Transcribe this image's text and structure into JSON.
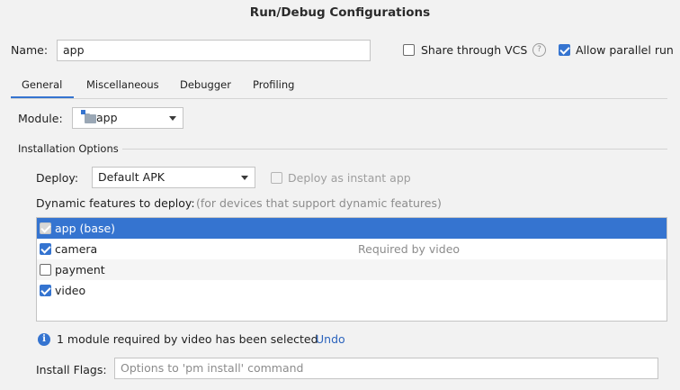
{
  "dialog": {
    "title": "Run/Debug Configurations"
  },
  "name_row": {
    "label": "Name:",
    "value": "app",
    "share_vcs_label": "Share through VCS",
    "share_vcs_checked": false,
    "help_glyph": "?",
    "allow_parallel_label": "Allow parallel run",
    "allow_parallel_checked": true
  },
  "tabs": [
    {
      "label": "General",
      "active": true
    },
    {
      "label": "Miscellaneous",
      "active": false
    },
    {
      "label": "Debugger",
      "active": false
    },
    {
      "label": "Profiling",
      "active": false
    }
  ],
  "module": {
    "label": "Module:",
    "value": "app",
    "icon": "module-folder-icon"
  },
  "installation": {
    "section_title": "Installation Options",
    "deploy_label": "Deploy:",
    "deploy_value": "Default APK",
    "instant_app_label": "Deploy as instant app",
    "instant_app_checked": false,
    "dynamic_label": "Dynamic features to deploy:",
    "dynamic_hint": "(for devices that support dynamic features)",
    "features": [
      {
        "name": "app (base)",
        "checked": true,
        "disabled": true,
        "selected": true,
        "note": ""
      },
      {
        "name": "camera",
        "checked": true,
        "disabled": false,
        "selected": false,
        "note": "Required by video"
      },
      {
        "name": "payment",
        "checked": false,
        "disabled": false,
        "selected": false,
        "note": ""
      },
      {
        "name": "video",
        "checked": true,
        "disabled": false,
        "selected": false,
        "note": ""
      }
    ],
    "info_glyph": "i",
    "info_message": "1 module required by video has been selected",
    "undo_label": "Undo",
    "install_flags_label": "Install Flags:",
    "install_flags_placeholder": "Options to 'pm install' command"
  },
  "colors": {
    "accent": "#3574d0",
    "background": "#f2f2f2",
    "link": "#2c64bd"
  }
}
